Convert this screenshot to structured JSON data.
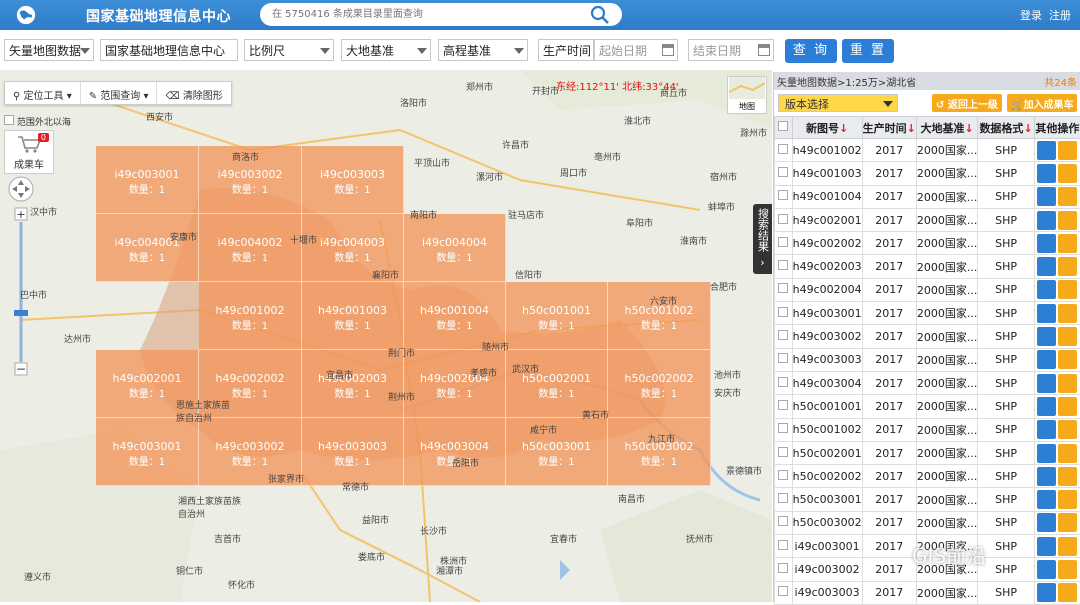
{
  "header": {
    "site_title": "国家基础地理信息中心",
    "search_placeholder": "在 5750416 条成果目录里面查询",
    "login": "登录",
    "register": "注册"
  },
  "filters": {
    "data_type": "矢量地图数据",
    "center": "国家基础地理信息中心",
    "scale": "比例尺",
    "datum": "大地基准",
    "height_datum": "高程基准",
    "production_time_label": "生产时间",
    "start_date": "起始日期",
    "end_date": "结束日期",
    "query_button": "查 询",
    "reset_button": "重 置"
  },
  "map": {
    "tools": [
      "定位工具",
      "范围查询",
      "清除图形"
    ],
    "coord": "东经:112°11' 北纬:33°44'",
    "range_label": "范围外北以海",
    "cart_label": "成果车",
    "cart_count": "0",
    "basemap_label": "地图",
    "result_tab": "搜索结果",
    "cells": [
      {
        "code": "i49c003001",
        "count": "数量：1"
      },
      {
        "code": "i49c003002",
        "count": "数量：1"
      },
      {
        "code": "i49c003003",
        "count": "数量：1"
      },
      {
        "code": "i49c004001",
        "count": "数量：1"
      },
      {
        "code": "i49c004002",
        "count": "数量：1"
      },
      {
        "code": "i49c004003",
        "count": "数量：1"
      },
      {
        "code": "i49c004004",
        "count": "数量：1"
      },
      {
        "code": "h49c001002",
        "count": "数量：1"
      },
      {
        "code": "h49c001003",
        "count": "数量：1"
      },
      {
        "code": "h49c001004",
        "count": "数量：1"
      },
      {
        "code": "h50c001001",
        "count": "数量：1"
      },
      {
        "code": "h50c001002",
        "count": "数量：1"
      },
      {
        "code": "h49c002001",
        "count": "数量：1"
      },
      {
        "code": "h49c002002",
        "count": "数量：1"
      },
      {
        "code": "h49c002003",
        "count": "数量：1"
      },
      {
        "code": "h49c002004",
        "count": "数量：1"
      },
      {
        "code": "h50c002001",
        "count": "数量：1"
      },
      {
        "code": "h50c002002",
        "count": "数量：1"
      },
      {
        "code": "h49c003001",
        "count": "数量：1"
      },
      {
        "code": "h49c003002",
        "count": "数量：1"
      },
      {
        "code": "h49c003003",
        "count": "数量：1"
      },
      {
        "code": "h49c003004",
        "count": "数量：1"
      },
      {
        "code": "h50c003001",
        "count": "数量：1"
      },
      {
        "code": "h50c003002",
        "count": "数量：1"
      }
    ],
    "cities": [
      "西安市",
      "商洛市",
      "洛阳市",
      "郑州市",
      "开封市",
      "商丘市",
      "许昌市",
      "平顶山市",
      "漯河市",
      "周口市",
      "亳州市",
      "南阳市",
      "驻马店市",
      "阜阳市",
      "安康市",
      "十堰市",
      "信阳市",
      "六安市",
      "合肥市",
      "汉中市",
      "巴中市",
      "达州市",
      "襄阳市",
      "随州市",
      "荆门市",
      "宜昌市",
      "孝感市",
      "武汉市",
      "黄石市",
      "九江市",
      "恩施土家族苗族自治州",
      "荆州市",
      "咸宁市",
      "岳阳市",
      "常德市",
      "张家界市",
      "南昌市",
      "益阳市",
      "长沙市",
      "湘西土家族苗族自治州",
      "吉首市",
      "宜春市",
      "株洲市",
      "湘潭市",
      "抚州市",
      "铜仁市",
      "怀化市",
      "娄底市",
      "遵义市",
      "池州市",
      "安庆市",
      "景德镇市",
      "淮南市",
      "宿州市",
      "蚌埠市",
      "滁州市",
      "淮北市"
    ]
  },
  "panel": {
    "breadcrumb": "矢量地图数据>1:25万>湖北省",
    "total": "共24条",
    "version_select": "版本选择",
    "back_button": "返回上一级",
    "add_cart_button": "加入成果车",
    "columns": [
      "新图号",
      "生产时间",
      "大地基准",
      "数据格式",
      "其他操作"
    ],
    "rows": [
      {
        "id": "h49c001002",
        "year": "2017",
        "datum": "2000国家...",
        "fmt": "SHP"
      },
      {
        "id": "h49c001003",
        "year": "2017",
        "datum": "2000国家...",
        "fmt": "SHP"
      },
      {
        "id": "h49c001004",
        "year": "2017",
        "datum": "2000国家...",
        "fmt": "SHP"
      },
      {
        "id": "h49c002001",
        "year": "2017",
        "datum": "2000国家...",
        "fmt": "SHP"
      },
      {
        "id": "h49c002002",
        "year": "2017",
        "datum": "2000国家...",
        "fmt": "SHP"
      },
      {
        "id": "h49c002003",
        "year": "2017",
        "datum": "2000国家...",
        "fmt": "SHP"
      },
      {
        "id": "h49c002004",
        "year": "2017",
        "datum": "2000国家...",
        "fmt": "SHP"
      },
      {
        "id": "h49c003001",
        "year": "2017",
        "datum": "2000国家...",
        "fmt": "SHP"
      },
      {
        "id": "h49c003002",
        "year": "2017",
        "datum": "2000国家...",
        "fmt": "SHP"
      },
      {
        "id": "h49c003003",
        "year": "2017",
        "datum": "2000国家...",
        "fmt": "SHP"
      },
      {
        "id": "h49c003004",
        "year": "2017",
        "datum": "2000国家...",
        "fmt": "SHP"
      },
      {
        "id": "h50c001001",
        "year": "2017",
        "datum": "2000国家...",
        "fmt": "SHP"
      },
      {
        "id": "h50c001002",
        "year": "2017",
        "datum": "2000国家...",
        "fmt": "SHP"
      },
      {
        "id": "h50c002001",
        "year": "2017",
        "datum": "2000国家...",
        "fmt": "SHP"
      },
      {
        "id": "h50c002002",
        "year": "2017",
        "datum": "2000国家...",
        "fmt": "SHP"
      },
      {
        "id": "h50c003001",
        "year": "2017",
        "datum": "2000国家...",
        "fmt": "SHP"
      },
      {
        "id": "h50c003002",
        "year": "2017",
        "datum": "2000国家...",
        "fmt": "SHP"
      },
      {
        "id": "i49c003001",
        "year": "2017",
        "datum": "2000国家...",
        "fmt": "SHP"
      },
      {
        "id": "i49c003002",
        "year": "2017",
        "datum": "2000国家...",
        "fmt": "SHP"
      },
      {
        "id": "i49c003003",
        "year": "2017",
        "datum": "2000国家...",
        "fmt": "SHP"
      }
    ]
  },
  "watermark": "GIS前沿",
  "colors": {
    "header": "#2f7cc8",
    "accent": "#f6a91b",
    "grid": "#f4965a",
    "button": "#2b7dd6"
  }
}
